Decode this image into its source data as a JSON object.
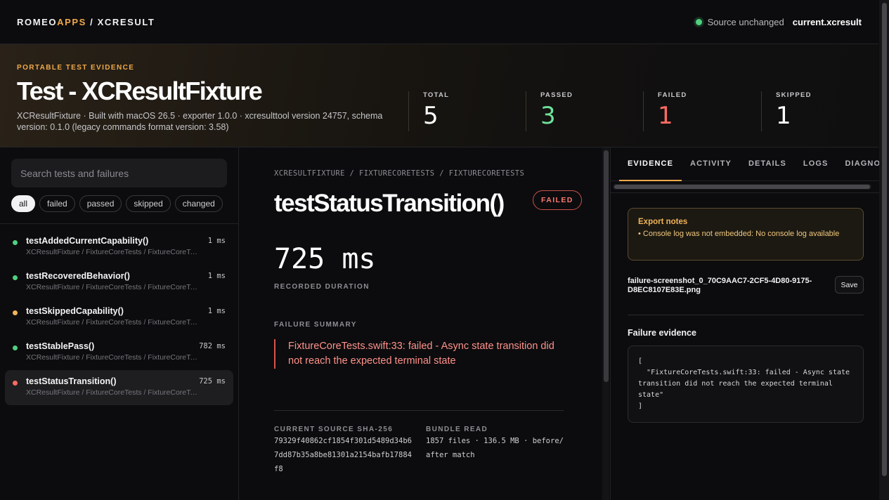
{
  "header": {
    "brand_primary": "ROMEO",
    "brand_accent": "APPS",
    "brand_suffix": " / XCRESULT",
    "source_status": "Source unchanged",
    "source_file": "current.xcresult"
  },
  "hero": {
    "eyebrow": "PORTABLE TEST EVIDENCE",
    "title": "Test - XCResultFixture",
    "subtitle": "XCResultFixture · Built with macOS 26.5 · exporter 1.0.0 · xcresulttool version 24757, schema version: 0.1.0 (legacy commands format version: 3.58)",
    "stats": [
      {
        "label": "TOTAL",
        "value": "5",
        "color": "#ffffff"
      },
      {
        "label": "PASSED",
        "value": "3",
        "color": "#6ee29a"
      },
      {
        "label": "FAILED",
        "value": "1",
        "color": "#ff6b61"
      },
      {
        "label": "SKIPPED",
        "value": "1",
        "color": "#ffffff"
      }
    ]
  },
  "sidebar": {
    "search_placeholder": "Search tests and failures",
    "filters": [
      "all",
      "failed",
      "passed",
      "skipped",
      "changed"
    ],
    "active_filter": "all",
    "tests": [
      {
        "name": "testAddedCurrentCapability()",
        "time": "1 ms",
        "path": "XCResultFixture / FixtureCoreTests / FixtureCoreTests",
        "status": "passed",
        "color": "#4fd17f"
      },
      {
        "name": "testRecoveredBehavior()",
        "time": "1 ms",
        "path": "XCResultFixture / FixtureCoreTests / FixtureCoreTests",
        "status": "passed",
        "color": "#4fd17f"
      },
      {
        "name": "testSkippedCapability()",
        "time": "1 ms",
        "path": "XCResultFixture / FixtureCoreTests / FixtureCoreTests",
        "status": "skipped",
        "color": "#f0b45a"
      },
      {
        "name": "testStablePass()",
        "time": "782 ms",
        "path": "XCResultFixture / FixtureCoreTests / FixtureCoreTests",
        "status": "passed",
        "color": "#4fd17f"
      },
      {
        "name": "testStatusTransition()",
        "time": "725 ms",
        "path": "XCResultFixture / FixtureCoreTests / FixtureCoreTests",
        "status": "failed",
        "color": "#ff6b61"
      }
    ]
  },
  "detail": {
    "breadcrumb": "XCRESULTFIXTURE / FIXTURECORETESTS / FIXTURECORETESTS",
    "title": "testStatusTransition()",
    "badge": "FAILED",
    "duration": "725 ms",
    "duration_label": "RECORDED DURATION",
    "summary_label": "FAILURE SUMMARY",
    "summary": "FixtureCoreTests.swift:33: failed - Async state transition did not reach the expected terminal state",
    "sha_label": "CURRENT SOURCE SHA-256",
    "sha_value": "79329f40862cf1854f301d5489d34b67dd87b35a8be81301a2154bafb17884f8",
    "bundle_label": "BUNDLE READ",
    "bundle_value": "1857 files · 136.5 MB · before/after match"
  },
  "panel": {
    "tabs": [
      "EVIDENCE",
      "ACTIVITY",
      "DETAILS",
      "LOGS",
      "DIAGNOSTICS"
    ],
    "active_tab": "EVIDENCE",
    "notes_title": "Export notes",
    "notes_line": "• Console log was not embedded: No console log available",
    "attachment_name": "failure-screenshot_0_70C9AAC7-2CF5-4D80-9175-D8EC8107E83E.png",
    "save_label": "Save",
    "evidence_title": "Failure evidence",
    "evidence_code": [
      "[",
      "  \"FixtureCoreTests.swift:33: failed - Async state transition did not reach the expected terminal state\"",
      "]"
    ]
  }
}
